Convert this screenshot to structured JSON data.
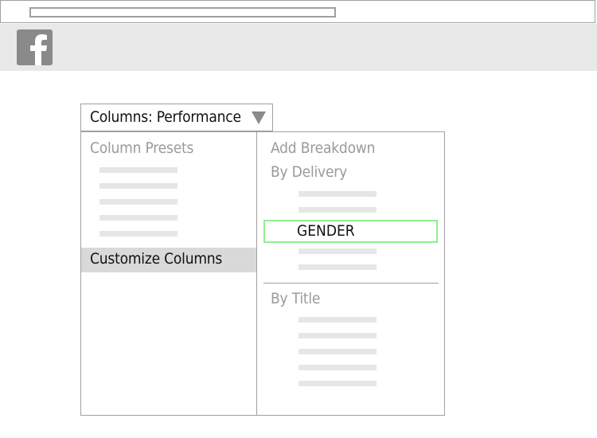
{
  "toolbar": {
    "dropdown_label": "Columns: Performance"
  },
  "menu": {
    "left": {
      "presets_heading": "Column Presets",
      "customize_label": "Customize Columns"
    },
    "right": {
      "add_breakdown_heading": "Add Breakdown",
      "by_delivery_heading": "By Delivery",
      "gender_label": "GENDER",
      "by_title_heading": "By Title"
    }
  },
  "colors": {
    "highlight_border": "#90ee90",
    "selected_row_bg": "#d9d9d9",
    "logo_bg": "#8a8a8a"
  },
  "icons": {
    "logo": "facebook-icon",
    "dropdown": "triangle-down-icon"
  }
}
